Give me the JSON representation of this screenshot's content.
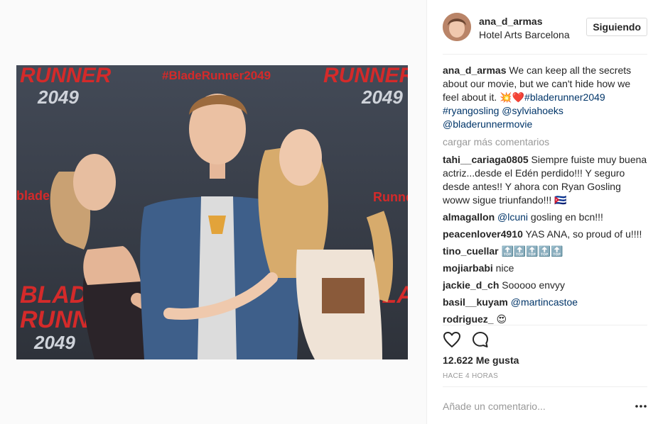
{
  "post": {
    "owner": "ana_d_armas",
    "location": "Hotel Arts Barcelona",
    "follow_label": "Siguiendo",
    "photo_texts": {
      "hashtag": "#BladeRunner2049",
      "runner": "RUNNER",
      "year": "2049",
      "blade": "BLADE",
      "blade_side": "blade",
      "runner_side": "Runner"
    },
    "caption": {
      "user": "ana_d_armas",
      "text": " We can keep all the secrets about our movie, but we can't hide how we feel about it. 💥❤️",
      "tags": [
        "#bladerunner2049",
        "#ryangosling",
        "@sylviahoeks",
        "@bladerunnermovie"
      ]
    },
    "load_more": "cargar más comentarios",
    "comments": [
      {
        "user": "tahi__cariaga0805",
        "text": " Siempre fuiste muy buena actriz...desde el Edén perdido!!! Y seguro desde antes!! Y ahora con Ryan Gosling woww sigue triunfando!!! 🇨🇺",
        "mention": ""
      },
      {
        "user": "almagallon",
        "text": " gosling en bcn!!!",
        "mention": "@lcuni"
      },
      {
        "user": "peacenlover4910",
        "text": " YAS ANA, so proud of u!!!!",
        "mention": ""
      },
      {
        "user": "tino_cuellar",
        "text": " 🔝🔝🔝🔝🔝",
        "mention": ""
      },
      {
        "user": "mojiarbabi",
        "text": " nice",
        "mention": ""
      },
      {
        "user": "jackie_d_ch",
        "text": " Sooooo envyy",
        "mention": ""
      },
      {
        "user": "basil__kuyam",
        "text": "",
        "mention": "@martincastoe"
      },
      {
        "user": "rodriguez_",
        "text": " 😍",
        "mention": ""
      }
    ],
    "likes_label": "12.622 Me gusta",
    "time_label": "HACE 4 HORAS",
    "add_comment_placeholder": "Añade un comentario...",
    "icons": [
      "heart-icon",
      "comment-icon",
      "more-options-icon"
    ]
  }
}
